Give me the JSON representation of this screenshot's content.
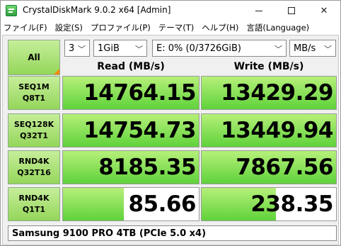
{
  "window": {
    "title": "CrystalDiskMark 9.0.2 x64 [Admin]"
  },
  "menu": [
    "ファイル(F)",
    "設定(S)",
    "プロファイル(P)",
    "テーマ(T)",
    "ヘルプ(H)",
    "言語(Language)"
  ],
  "controls": {
    "all_label": "All",
    "count": "3",
    "size": "1GiB",
    "drive": "E: 0% (0/3726GiB)",
    "unit": "MB/s"
  },
  "headers": {
    "read": "Read (MB/s)",
    "write": "Write (MB/s)"
  },
  "rows": [
    {
      "line1": "SEQ1M",
      "line2": "Q8T1",
      "read": "14764.15",
      "write": "13429.29",
      "read_fill": 1.0,
      "write_fill": 1.0
    },
    {
      "line1": "SEQ128K",
      "line2": "Q32T1",
      "read": "14754.73",
      "write": "13449.94",
      "read_fill": 1.0,
      "write_fill": 1.0
    },
    {
      "line1": "RND4K",
      "line2": "Q32T16",
      "read": "8185.35",
      "write": "7867.56",
      "read_fill": 1.0,
      "write_fill": 1.0
    },
    {
      "line1": "RND4K",
      "line2": "Q1T1",
      "read": "85.66",
      "write": "238.35",
      "read_fill": 0.45,
      "write_fill": 0.55
    }
  ],
  "comment": "Samsung 9100 PRO 4TB (PCIe 5.0 x4)",
  "colors": {
    "accent": "#94d65a",
    "corner_marker": "#ff8a00"
  }
}
